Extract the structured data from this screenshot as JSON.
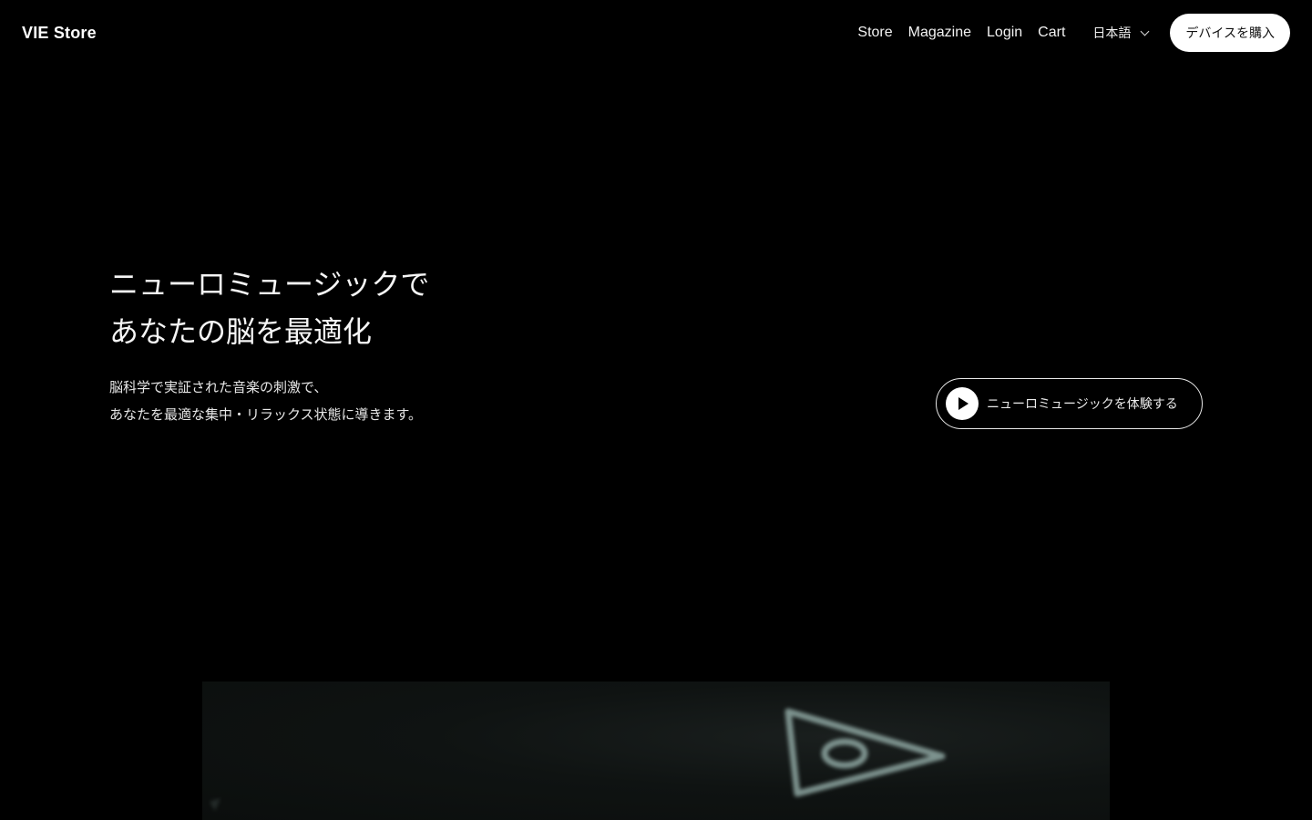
{
  "header": {
    "logo": "VIE Store",
    "nav": [
      "Store",
      "Magazine",
      "Login",
      "Cart"
    ],
    "language": "日本語",
    "buy_button": "デバイスを購入"
  },
  "hero": {
    "title_lines": [
      "ニューロミュージックで",
      "あなたの脳を最適化"
    ],
    "subtitle_lines": [
      "脳科学で実証された音楽の刺激で、",
      "あなたを最適な集中・リラックス状態に導きます。"
    ],
    "cta_label": "ニューロミュージックを体験する"
  },
  "media": {
    "icon": "triangle-logo-icon"
  },
  "colors": {
    "background": "#000000",
    "text": "#ffffff",
    "button_bg": "#ffffff",
    "media_icon": "#8fa7a3"
  }
}
